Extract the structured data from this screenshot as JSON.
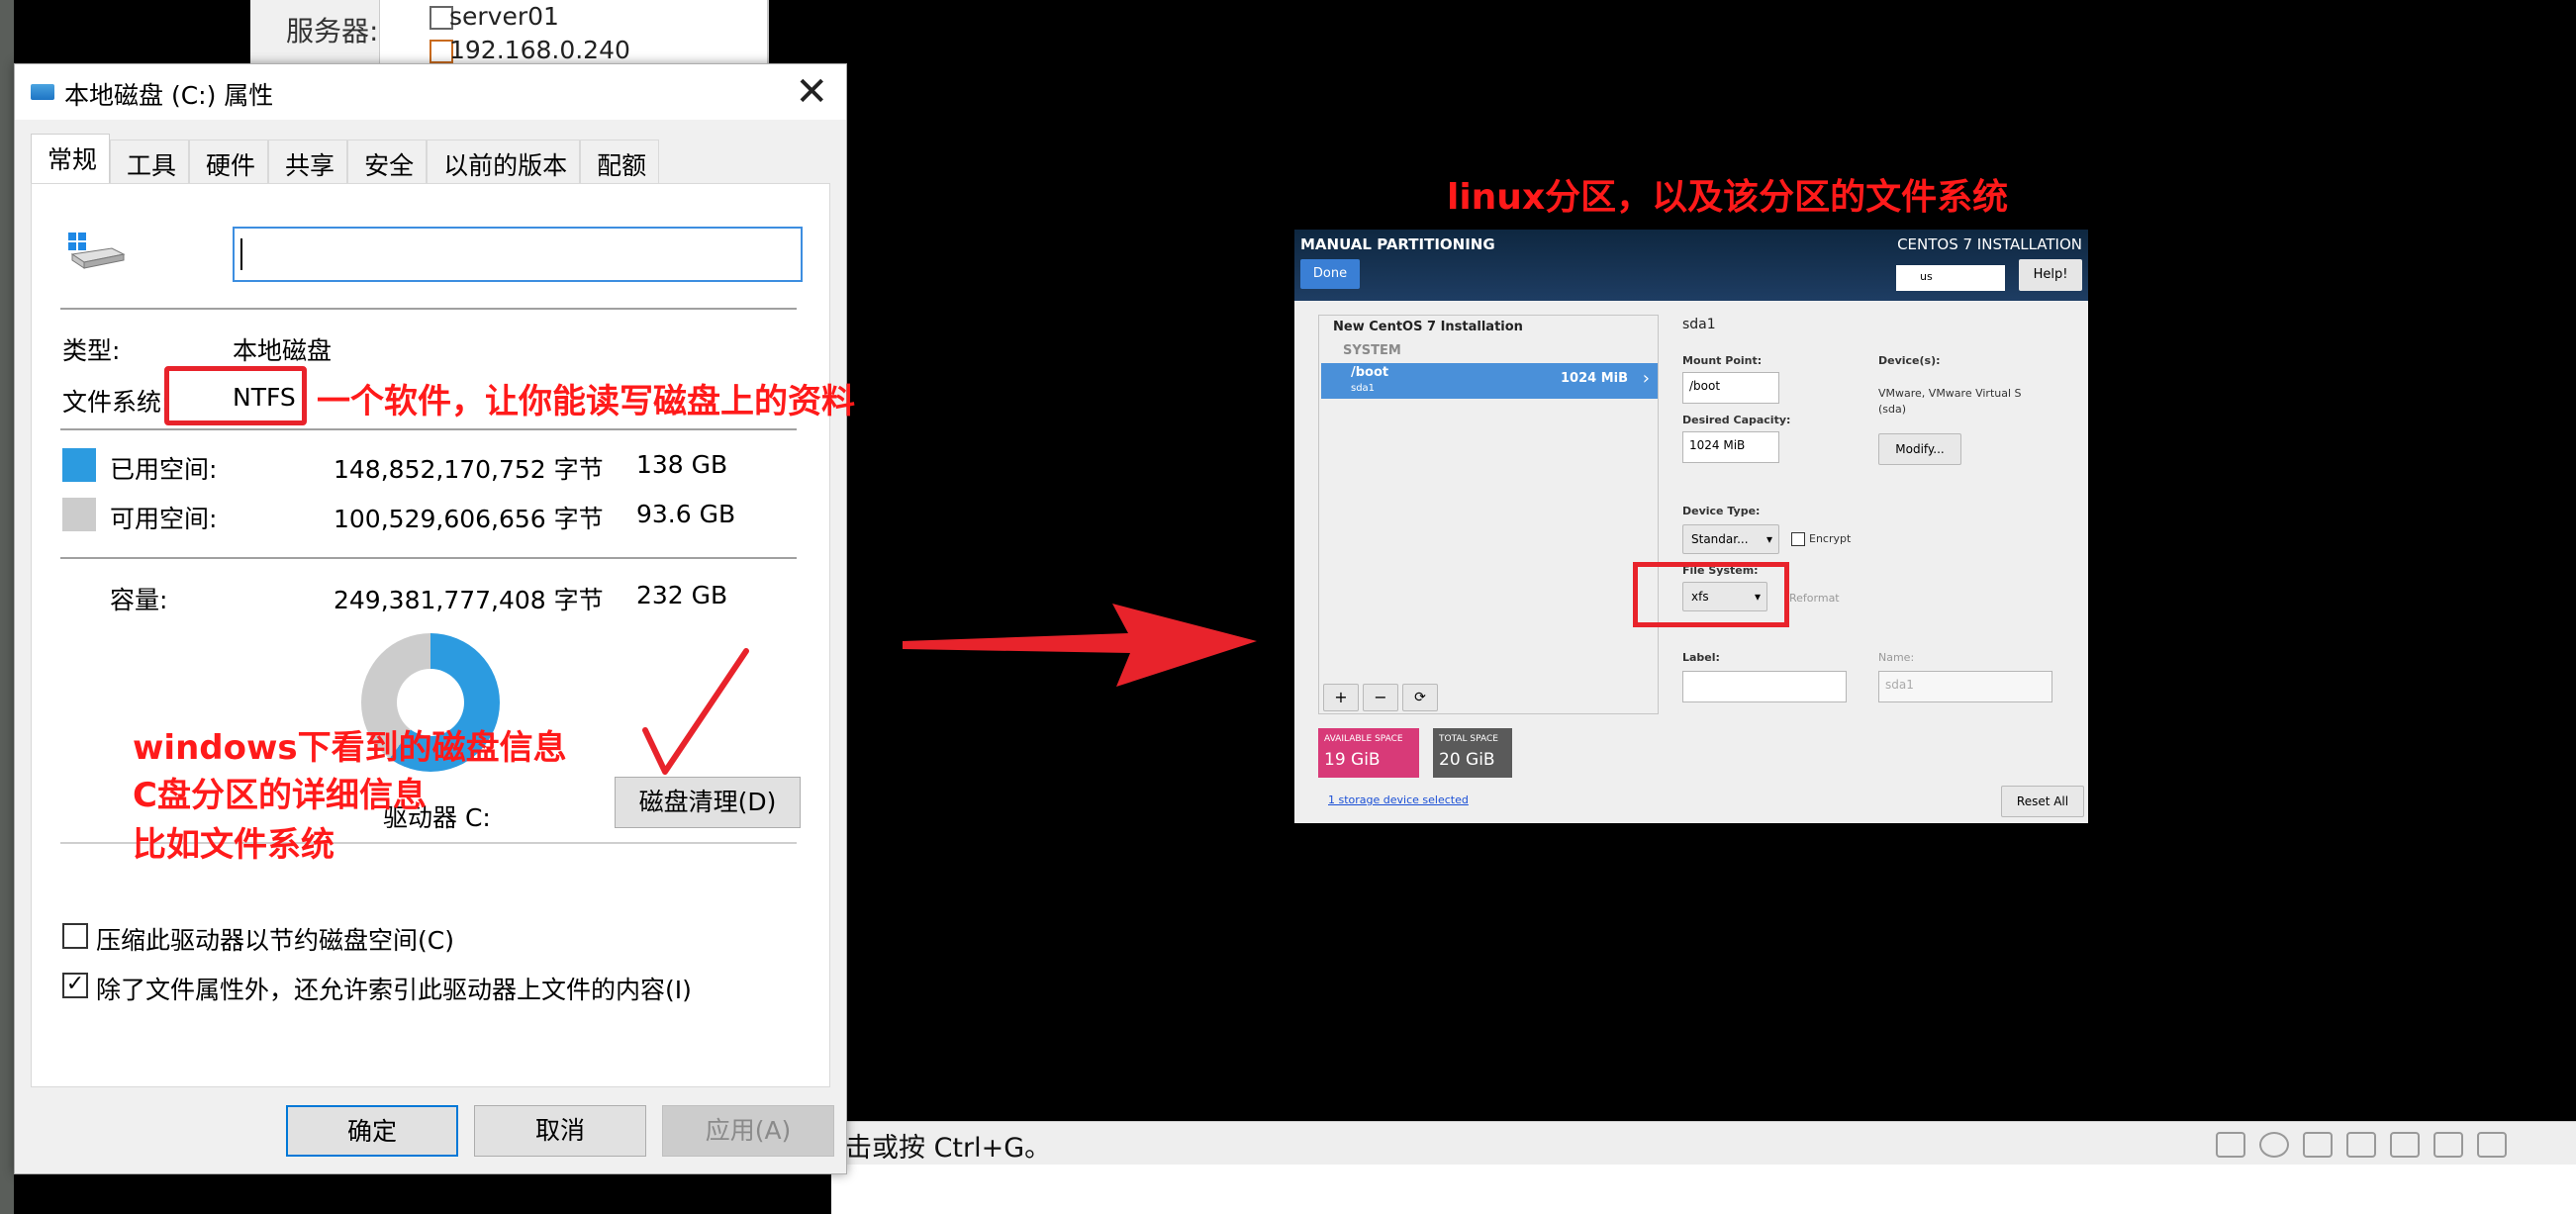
{
  "background": {
    "server_label": "服务器:",
    "server_items": [
      "server01",
      "192.168.0.240"
    ]
  },
  "statusbar": {
    "hint": "击或按 Ctrl+G。"
  },
  "props": {
    "title": "本地磁盘 (C:) 属性",
    "tabs": [
      "常规",
      "工具",
      "硬件",
      "共享",
      "安全",
      "以前的版本",
      "配额"
    ],
    "name_value": "",
    "type_label": "类型:",
    "type_value": "本地磁盘",
    "fs_label": "文件系统:",
    "fs_value": "NTFS",
    "used_label": "已用空间:",
    "used_bytes": "148,852,170,752 字节",
    "used_gb": "138 GB",
    "free_label": "可用空间:",
    "free_bytes": "100,529,606,656 字节",
    "free_gb": "93.6 GB",
    "cap_label": "容量:",
    "cap_bytes": "249,381,777,408 字节",
    "cap_gb": "232 GB",
    "used_fraction": 0.6,
    "drive_label": "驱动器 C:",
    "cleanup_button": "磁盘清理(D)",
    "compress_label": "压缩此驱动器以节约磁盘空间(C)",
    "compress_checked": false,
    "index_label": "除了文件属性外，还允许索引此驱动器上文件的内容(I)",
    "index_checked": true,
    "ok": "确定",
    "cancel": "取消",
    "apply": "应用(A)",
    "colors": {
      "used": "#2c9be0",
      "free": "#cccccc",
      "accent": "#0078d7"
    }
  },
  "annotations": {
    "fs_note": "一个软件，让你能读写磁盘上的资料",
    "win_note": [
      "windows下看到的磁盘信息",
      "C盘分区的详细信息",
      "比如文件系统"
    ],
    "linux_note": "linux分区，以及该分区的文件系统",
    "color": "#e8232b"
  },
  "centos": {
    "title": "MANUAL PARTITIONING",
    "product": "CENTOS 7 INSTALLATION",
    "done": "Done",
    "keyboard": "us",
    "help": "Help!",
    "install_group": "New CentOS 7 Installation",
    "system_label": "SYSTEM",
    "mount_name": "/boot",
    "mount_dev": "sda1",
    "mount_size": "1024 MiB",
    "detail_title": "sda1",
    "mount_point_label": "Mount Point:",
    "mount_point_value": "/boot",
    "desired_cap_label": "Desired Capacity:",
    "desired_cap_value": "1024 MiB",
    "devices_label": "Device(s):",
    "devices_value": "VMware, VMware Virtual S (sda)",
    "modify": "Modify...",
    "device_type_label": "Device Type:",
    "device_type_value": "Standar...",
    "encrypt": "Encrypt",
    "fs_label": "File System:",
    "fs_value": "xfs",
    "reformat": "Reformat",
    "label_label": "Label:",
    "name_label": "Name:",
    "name_value": "sda1",
    "avail_label": "AVAILABLE SPACE",
    "avail_value": "19 GiB",
    "total_label": "TOTAL SPACE",
    "total_value": "20 GiB",
    "storage_link": "1 storage device selected",
    "reset": "Reset All",
    "tool_buttons": [
      "+",
      "−",
      "⟳"
    ]
  }
}
